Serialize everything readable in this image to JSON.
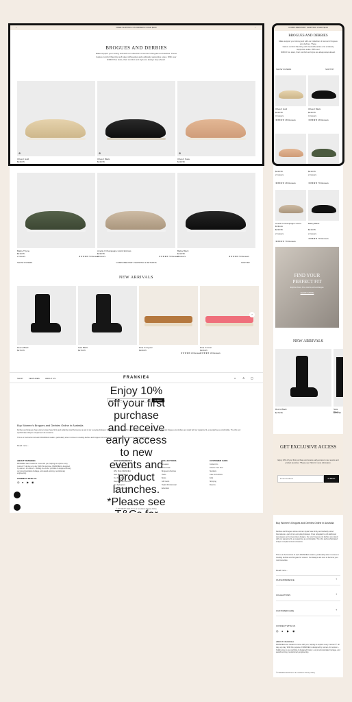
{
  "colors": {
    "page_bg": "#f3ece4",
    "banner_bg": "#f4ece2",
    "accent": "#111111"
  },
  "announcement": "FREE SHIPPING ON ORDERS OVER $100",
  "mobile_announcement": "COMPLIMENTARY SHIPPING OVER $100",
  "collection": {
    "title": "BROGUES AND DERBIES",
    "desc_1": "Make support your strong suit with our collection of women's brogues and derbies. These",
    "desc_2": "feature comfort flaunting soft sleek silhouettes and endlessly supportive soles. With over",
    "desc_3": "$300.0 five stars, their comfort and style are always step ahead."
  },
  "products": [
    {
      "name": "Olivia II Gold",
      "price": "$249.95",
      "colors": "3 colours",
      "reviews": "★★★★★ 48 Reviews"
    },
    {
      "name": "Olivia II Black",
      "price": "$249.95",
      "colors": "3 colours",
      "reviews": "★★★★★ 48 Reviews"
    },
    {
      "name": "Olivia II Nude",
      "price": "$249.95",
      "colors": "2 colours",
      "reviews": "★★★★★ 48 Reviews"
    },
    {
      "name": "Bailey Thyme",
      "price": "$219.95",
      "colors": "2 colours",
      "reviews": "★★★★★ 79 Reviews"
    },
    {
      "name": "Amelia II Champagne Lizard Emboss",
      "price": "$239.95",
      "colors": "2 colours",
      "reviews": "★★★★★ 79 Reviews"
    },
    {
      "name": "Bailey Black",
      "price": "$219.95",
      "colors": "2 colours",
      "reviews": "★★★★★ 79 Reviews"
    }
  ],
  "filters": {
    "show": "SHOW FILTERS",
    "sort": "SORT BY",
    "complimentary": "COMPLIMENTARY SHIPPING & RETURNS"
  },
  "new_arrivals": {
    "title": "NEW ARRIVALS",
    "items": [
      {
        "name": "Rocco Black",
        "price": "$279.95",
        "reviews": ""
      },
      {
        "name": "Sola Black",
        "price": "$279.95",
        "reviews": ""
      },
      {
        "name": "Rina II Cognac",
        "price": "$169.95",
        "reviews": "★★★★★ 19 Reviews"
      },
      {
        "name": "Rina II Coral",
        "price": "$169.95",
        "reviews": "★★★★★ 19 Reviews"
      }
    ]
  },
  "nav": {
    "shop": "SHOP",
    "features": "FEATURES",
    "about": "ABOUT US",
    "logo": "FRANKIE4"
  },
  "signup": {
    "title": "GET EXCLUSIVE ACCESS",
    "text": "Enjoy 10% off your first purchase and receive early access to new events and product launches. *Please see T&Cs for more information.",
    "placeholder": "Email Address",
    "submit": "SUBMIT"
  },
  "seo": {
    "title": "Buy Women's Brogues and Derbies Online in Australia",
    "p1": "Derbies and brogues shoes women styles have firmly and defiantly stood themselves a part of our everyday footwear. Once relegated to old-fashioned stereotypes and conservative designs, the now brogues and derbies are styled with our signature fit, as supportive as comfortable. The chic and sophisticated shapes complement all occasions.",
    "p2": "This is at the forefront of each FRANKIE4 creation, particularly when it comes to creating derbies and brogues for women. Our designs are sure to become your new favourites.",
    "read_more": "Read more..."
  },
  "footer": {
    "about_title": "ABOUT FRANKIE4",
    "about_text": "FRANKIE4 was created to move with you, helping to explore every moment™ all day, any day. With this purpose, FRANKIE4 is designed by women, for women – holding true to our portfolio of designed history, our proud Australian heritage, and award-winning, revolutionary engineering.",
    "connect": "CONNECT WITH US",
    "col1_title": "OUR EXPERIENCE",
    "col1": [
      "About Us",
      "Certified B Corp Product",
      "Why Shop FRANKIE4",
      "New Brand Pass™",
      "Our Stylefinder",
      "Responsible Practices",
      "Our Stylespace",
      "Impact & Stewardship",
      "Careers"
    ],
    "col2_title": "COLLECTIONS",
    "col2": [
      "Sneakers",
      "Dress Flats",
      "Brogues & Derbies",
      "Heels",
      "Boots",
      "Gift Cards",
      "Health Professional",
      "Education"
    ],
    "col3_title": "CUSTOMER CARE",
    "col3": [
      "Contact Us",
      "Choose Your Size",
      "Stockists",
      "Care Instructions",
      "FAQ",
      "Shipping",
      "Returns"
    ],
    "accordion": [
      "OUR EXPERIENCE",
      "COLLECTIONS",
      "CUSTOMER CARE"
    ],
    "copyright": "© FRANKIE4 2023   Terms & Conditions   Privacy Policy"
  },
  "banner": {
    "title_1": "FIND YOUR",
    "title_2": "PERFECT FIT",
    "subtitle": "Explore shoes. Free returns and exchanges.",
    "cta": "LEARN MORE"
  }
}
